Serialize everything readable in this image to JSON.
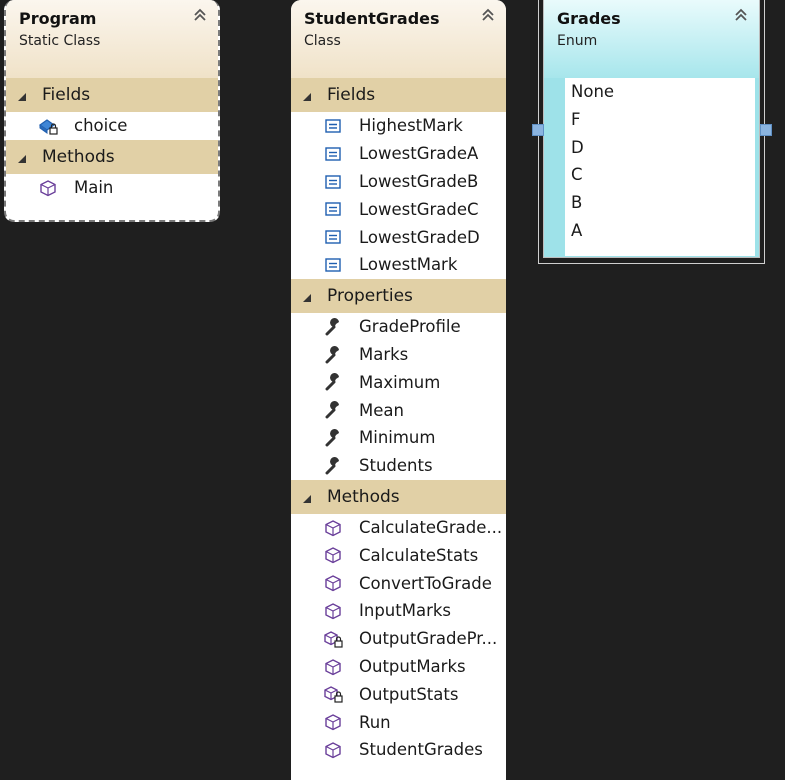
{
  "program": {
    "title": "Program",
    "kind": "Static Class",
    "sections": {
      "fields_label": "Fields",
      "methods_label": "Methods"
    },
    "fields": [
      {
        "name": "choice",
        "icon": "private-field-icon"
      }
    ],
    "methods": [
      {
        "name": "Main",
        "icon": "method-icon"
      }
    ]
  },
  "student_grades": {
    "title": "StudentGrades",
    "kind": "Class",
    "sections": {
      "fields_label": "Fields",
      "properties_label": "Properties",
      "methods_label": "Methods"
    },
    "fields": [
      "HighestMark",
      "LowestGradeA",
      "LowestGradeB",
      "LowestGradeC",
      "LowestGradeD",
      "LowestMark"
    ],
    "properties": [
      "GradeProfile",
      "Marks",
      "Maximum",
      "Mean",
      "Minimum",
      "Students"
    ],
    "methods": [
      {
        "name": "CalculateGrade...",
        "private": false
      },
      {
        "name": "CalculateStats",
        "private": false
      },
      {
        "name": "ConvertToGrade",
        "private": false
      },
      {
        "name": "InputMarks",
        "private": false
      },
      {
        "name": "OutputGradePr...",
        "private": true
      },
      {
        "name": "OutputMarks",
        "private": false
      },
      {
        "name": "OutputStats",
        "private": true
      },
      {
        "name": "Run",
        "private": false
      },
      {
        "name": "StudentGrades",
        "private": false
      }
    ]
  },
  "grades": {
    "title": "Grades",
    "kind": "Enum",
    "values": [
      "None",
      "F",
      "D",
      "C",
      "B",
      "A"
    ]
  },
  "colors": {
    "canvas": "#1f1f1f",
    "class_header": "#f0e2c8",
    "section_band": "#e1d0a6",
    "enum_header": "#a7e6ec",
    "method_icon": "#6a3f9a",
    "field_icon": "#1f5fb0"
  }
}
